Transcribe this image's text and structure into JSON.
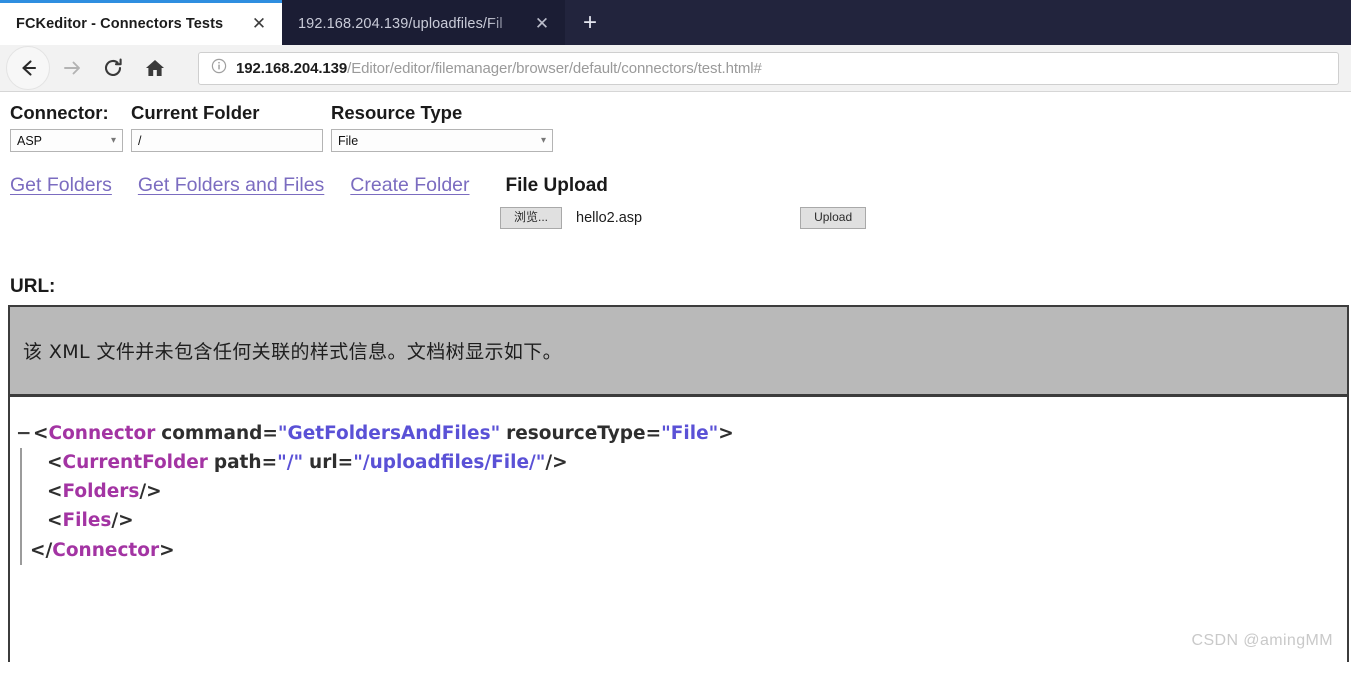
{
  "browser": {
    "tabs": [
      {
        "title": "FCKeditor - Connectors Tests",
        "active": true,
        "close_label": "✕"
      },
      {
        "title": "192.168.204.139/uploadfiles/Fil",
        "active": false,
        "close_label": "✕"
      }
    ],
    "new_tab_label": "+",
    "nav": {
      "back_icon": "arrow-left-icon",
      "forward_icon": "arrow-right-icon",
      "reload_icon": "reload-icon",
      "home_icon": "home-icon"
    },
    "omnibox": {
      "info_icon": "info-circle-icon",
      "url_host": "192.168.204.139",
      "url_path": "/Editor/editor/filemanager/browser/default/connectors/test.html#",
      "full_url": "192.168.204.139/Editor/editor/filemanager/browser/default/connectors/test.html#"
    },
    "accent_color": "#2f8ee0",
    "tabstrip_color": "#22243d"
  },
  "form": {
    "connector": {
      "label": "Connector:",
      "value": "ASP"
    },
    "current_folder": {
      "label": "Current Folder",
      "value": "/"
    },
    "resource_type": {
      "label": "Resource Type",
      "value": "File"
    }
  },
  "actions": {
    "get_folders": "Get Folders",
    "get_folders_and_files": "Get Folders and Files",
    "create_folder": "Create Folder",
    "file_upload_label": "File Upload",
    "browse_button": "浏览...",
    "selected_file": "hello2.asp",
    "upload_button": "Upload",
    "link_color": "#7b6cc0"
  },
  "result": {
    "url_heading": "URL:",
    "banner_text": "该 XML 文件并未包含任何关联的样式信息。文档树显示如下。",
    "banner_bg": "#b9b9b9",
    "xml": {
      "twisty": "−",
      "line1": {
        "open": "<",
        "tag": "Connector",
        "attr1": "command",
        "eq": "=",
        "val1": "\"GetFoldersAndFiles\"",
        "attr2": "resourceType",
        "val2": "\"File\"",
        "close": ">"
      },
      "line2": {
        "open": "<",
        "tag": "CurrentFolder",
        "attr1": "path",
        "eq": "=",
        "val1": "\"/\"",
        "attr2": "url",
        "val2": "\"/uploadfiles/File/\"",
        "close": "/>"
      },
      "line3": {
        "open": "<",
        "tag": "Folders",
        "close": "/>"
      },
      "line4": {
        "open": "<",
        "tag": "Files",
        "close": "/>"
      },
      "line5": {
        "open": "</",
        "tag": "Connector",
        "close": ">"
      },
      "tag_color": "#a334a3",
      "value_color": "#5a51d6"
    }
  },
  "watermark": "CSDN @amingMM"
}
